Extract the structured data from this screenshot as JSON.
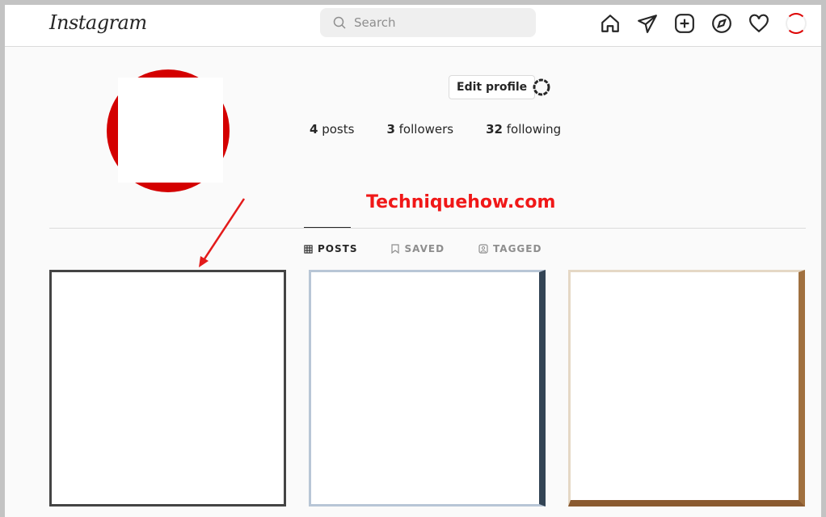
{
  "nav": {
    "logo": "Instagram",
    "search_placeholder": "Search",
    "icons": [
      "home-icon",
      "direct-message-icon",
      "new-post-icon",
      "explore-icon",
      "activity-heart-icon",
      "profile-avatar"
    ]
  },
  "profile": {
    "edit_button": "Edit profile",
    "stats": {
      "posts_count": "4",
      "posts_label": "posts",
      "followers_count": "3",
      "followers_label": "followers",
      "following_count": "32",
      "following_label": "following"
    }
  },
  "watermark": "Techniquehow.com",
  "tabs": [
    {
      "label": "POSTS",
      "icon": "grid-icon",
      "active": true
    },
    {
      "label": "SAVED",
      "icon": "bookmark-icon"
    },
    {
      "label": "TAGGED",
      "icon": "tag-icon"
    }
  ],
  "colors": {
    "accent_red": "#f01818",
    "avatar_ring": "#d40000"
  }
}
